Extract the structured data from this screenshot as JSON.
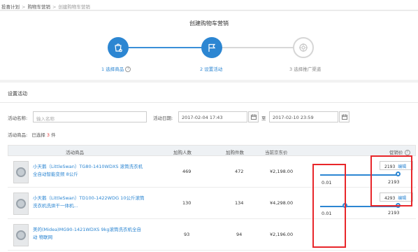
{
  "breadcrumb": {
    "items": [
      "投喜计划",
      "购物车营销"
    ],
    "current": "创建购物车营销",
    "separator": ">"
  },
  "steps": {
    "title": "创建购物车营销",
    "items": [
      {
        "label": "1 选择商品",
        "icon": "cart-icon",
        "state": "done"
      },
      {
        "label": "2 设置活动",
        "icon": "flag-icon",
        "state": "active"
      },
      {
        "label": "3 选择推广渠道",
        "icon": "channel-icon",
        "state": "pending"
      }
    ],
    "colors": {
      "active": "#2c86d2",
      "pending": "#d6d6d6"
    }
  },
  "settings": {
    "title": "设置活动",
    "name_label": "活动名称:",
    "name_placeholder": "输入名称",
    "date_label": "活动日期:",
    "start_date": "2017-02-04 17:43",
    "to": "至",
    "end_date": "2017-02-10 23:59",
    "items_label": "活动商品:",
    "selected_prefix": "已选择",
    "selected_count": "3",
    "selected_suffix": "件"
  },
  "table": {
    "headers": {
      "product": "活动商品",
      "buyers": "加购人数",
      "pieces": "加购件数",
      "jd_price": "当前京东价",
      "promo_price": "促销价"
    },
    "edit_label": "编辑",
    "rows": [
      {
        "name": "小天鹅（LittleSwan）TG80-1410WDXS 滚筒洗衣机 全自动智能变频 8公斤",
        "buyers": "469",
        "pieces": "472",
        "price": "¥2,198.00",
        "slider_min": "0.01",
        "slider_max": "2193",
        "promo": "2193"
      },
      {
        "name": "小天鹅（LittleSwan）TD100-1422WDG 10公斤滚筒洗衣机洗烘干一体机...",
        "buyers": "130",
        "pieces": "134",
        "price": "¥4,298.00",
        "slider_min": "0.01",
        "slider_max": "2193",
        "promo": "4293"
      },
      {
        "name": "美的(Midea)MG90-1421WDXS 9kg滚筒洗衣机全自动 物联网",
        "buyers": "93",
        "pieces": "94",
        "price": "¥2,196.00",
        "slider_min": "",
        "slider_max": "",
        "promo": ""
      }
    ]
  },
  "highlight_color": "#e8262a"
}
